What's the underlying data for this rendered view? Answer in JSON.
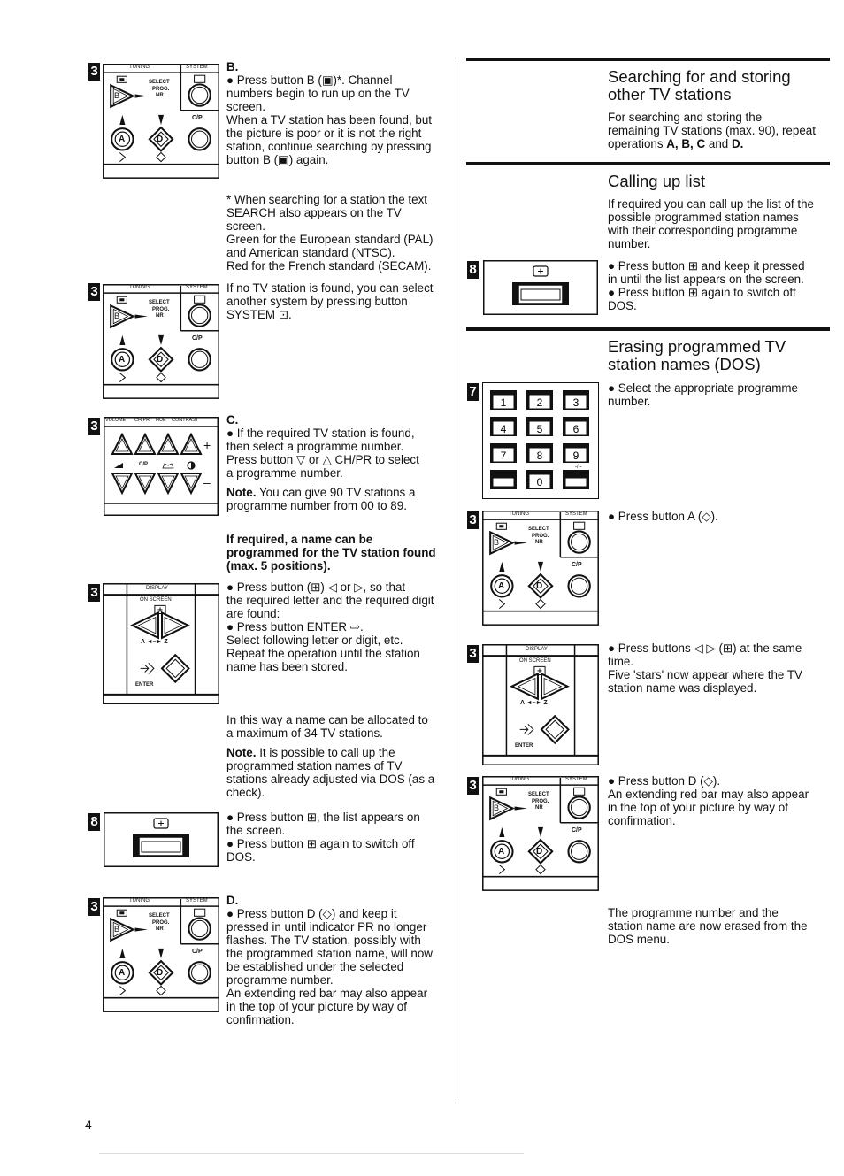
{
  "page_number": "4",
  "diagram_labels": {
    "badge_3": "3",
    "badge_8": "8",
    "badge_7": "7",
    "tuning": "TUNING",
    "system": "SYSTEM",
    "select": "SELECT",
    "prog": "PROG.",
    "nr": "NR",
    "cp": "C/P",
    "btn_a": "A",
    "btn_b": "B",
    "btn_d": "D",
    "volume": "VOLUME",
    "chpr": "CH.PR",
    "hue": "HUE",
    "contrast": "CONTRAST",
    "cp_small": "C/P",
    "plus": "+",
    "minus": "–",
    "display": "DISPLAY",
    "on_screen": "ON SCREEN",
    "a_to_z": "A ◄–► Z",
    "enter": "ENTER",
    "keypad": [
      "1",
      "2",
      "3",
      "4",
      "5",
      "6",
      "7",
      "8",
      "9",
      "",
      "0",
      ""
    ],
    "keypad_extra_label": "-/--"
  },
  "left_column": {
    "step_b": {
      "heading": "B.",
      "lines": [
        "● Press button B (▣)*. Channel",
        "numbers begin to run up on the TV",
        "screen.",
        "When a TV station has been found, but",
        "the picture is poor or it is not the right",
        "station, continue searching by pressing",
        "button B (▣) again."
      ]
    },
    "footnote": {
      "lines": [
        "* When searching for a station the text",
        "SEARCH also appears on the TV",
        "screen.",
        "Green for the European standard (PAL)",
        "and American standard (NTSC).",
        "Red for the French standard (SECAM)."
      ]
    },
    "no_station": {
      "lines": [
        "If no TV station is found, you can select",
        "another system by pressing button",
        "SYSTEM ⊡."
      ]
    },
    "step_c": {
      "heading": "C.",
      "lines": [
        "● If the required TV station is found,",
        "then select a programme number.",
        "Press button ▽ or △ CH/PR to select",
        "a programme number."
      ],
      "note_label": "Note.",
      "note_lines": [
        " You can give 90 TV stations a",
        "programme number from 00 to 89."
      ]
    },
    "name_intro": {
      "lines": [
        "If required, a name can be",
        "programmed for the TV station found",
        "(max. 5 positions)."
      ]
    },
    "name_steps": {
      "lines": [
        "● Press button (⊞) ◁ or ▷, so that",
        "the required letter and the required digit",
        "are found:",
        "● Press button ENTER ⇨.",
        "Select following letter or digit, etc.",
        "Repeat the operation until the station",
        "name has been stored."
      ]
    },
    "allocation": {
      "lines": [
        "In this way a name can be allocated to",
        "a maximum of 34 TV stations."
      ]
    },
    "note_dos": {
      "label": "Note.",
      "lines": [
        " It is possible to call up the",
        "programmed station names of TV",
        "stations already adjusted via DOS (as a",
        "check)."
      ]
    },
    "list_steps": {
      "lines": [
        "● Press button ⊞, the list appears on",
        "the screen.",
        "● Press button ⊞ again to switch off",
        "DOS."
      ]
    },
    "step_d": {
      "heading": "D.",
      "lines": [
        "● Press button D (◇) and keep it",
        "pressed in until indicator PR no longer",
        "flashes. The TV station, possibly with",
        "the programmed station name, will now",
        "be established under the selected",
        "programme number.",
        "An extending red bar may also appear",
        "in the top of your picture by way of",
        "confirmation."
      ]
    }
  },
  "right_column": {
    "searching": {
      "title_lines": [
        "Searching for and storing",
        "other TV stations"
      ],
      "body_lines": [
        "For searching and storing the",
        "remaining TV stations (max. 90), repeat"
      ],
      "body_last_prefix": "operations ",
      "body_last_bold": "A, B, C",
      "body_last_mid": " and ",
      "body_last_bold2": "D."
    },
    "calling": {
      "title": "Calling up list",
      "body_lines": [
        "If required you can call up the list of the",
        "possible programmed station names",
        "with their corresponding programme",
        "number."
      ],
      "step_lines": [
        "● Press button ⊞ and keep it pressed",
        "in until the list appears on the screen.",
        "● Press button ⊞ again to switch off",
        "DOS."
      ]
    },
    "erasing": {
      "title_lines": [
        "Erasing programmed TV",
        "station names (DOS)"
      ],
      "select_lines": [
        "● Select the appropriate programme",
        "number."
      ],
      "press_a": "● Press button A (◇).",
      "press_both_lines": [
        "● Press buttons ◁ ▷ (⊞) at the same",
        "time.",
        "Five 'stars' now appear where the TV",
        "station name was displayed."
      ],
      "press_d_lines": [
        "● Press button D (◇).",
        "An extending red bar may also appear",
        "in the top of your picture by way of",
        "confirmation."
      ],
      "final_lines": [
        "The programme number and the",
        "station name are now erased from the",
        "DOS menu."
      ]
    }
  }
}
